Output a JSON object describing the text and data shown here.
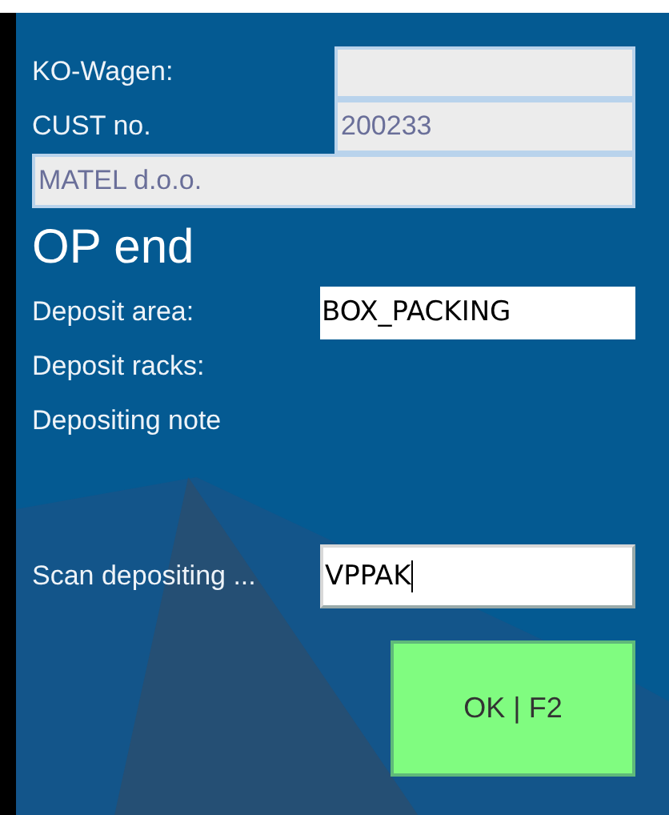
{
  "header_fields": [
    {
      "label": "KO-Wagen:",
      "kind": "readonly"
    },
    {
      "label": "CUST no.",
      "value": "200233",
      "kind": "readonly"
    }
  ],
  "customer_name": {
    "value": "MATEL d.o.o.",
    "kind": "readonly"
  },
  "title": "OP end",
  "detail_rows": [
    {
      "label": "Deposit area:",
      "field": {
        "value": "BOX_PACKING",
        "kind": "input",
        "focused": false
      }
    },
    {
      "label": "Deposit racks:"
    },
    {
      "label": "Depositing note"
    }
  ],
  "scan": {
    "label": "Scan depositing ...",
    "field": {
      "value": "VPPAK",
      "kind": "input",
      "focused": true
    }
  },
  "ok_button": {
    "label": "OK | F2"
  }
}
